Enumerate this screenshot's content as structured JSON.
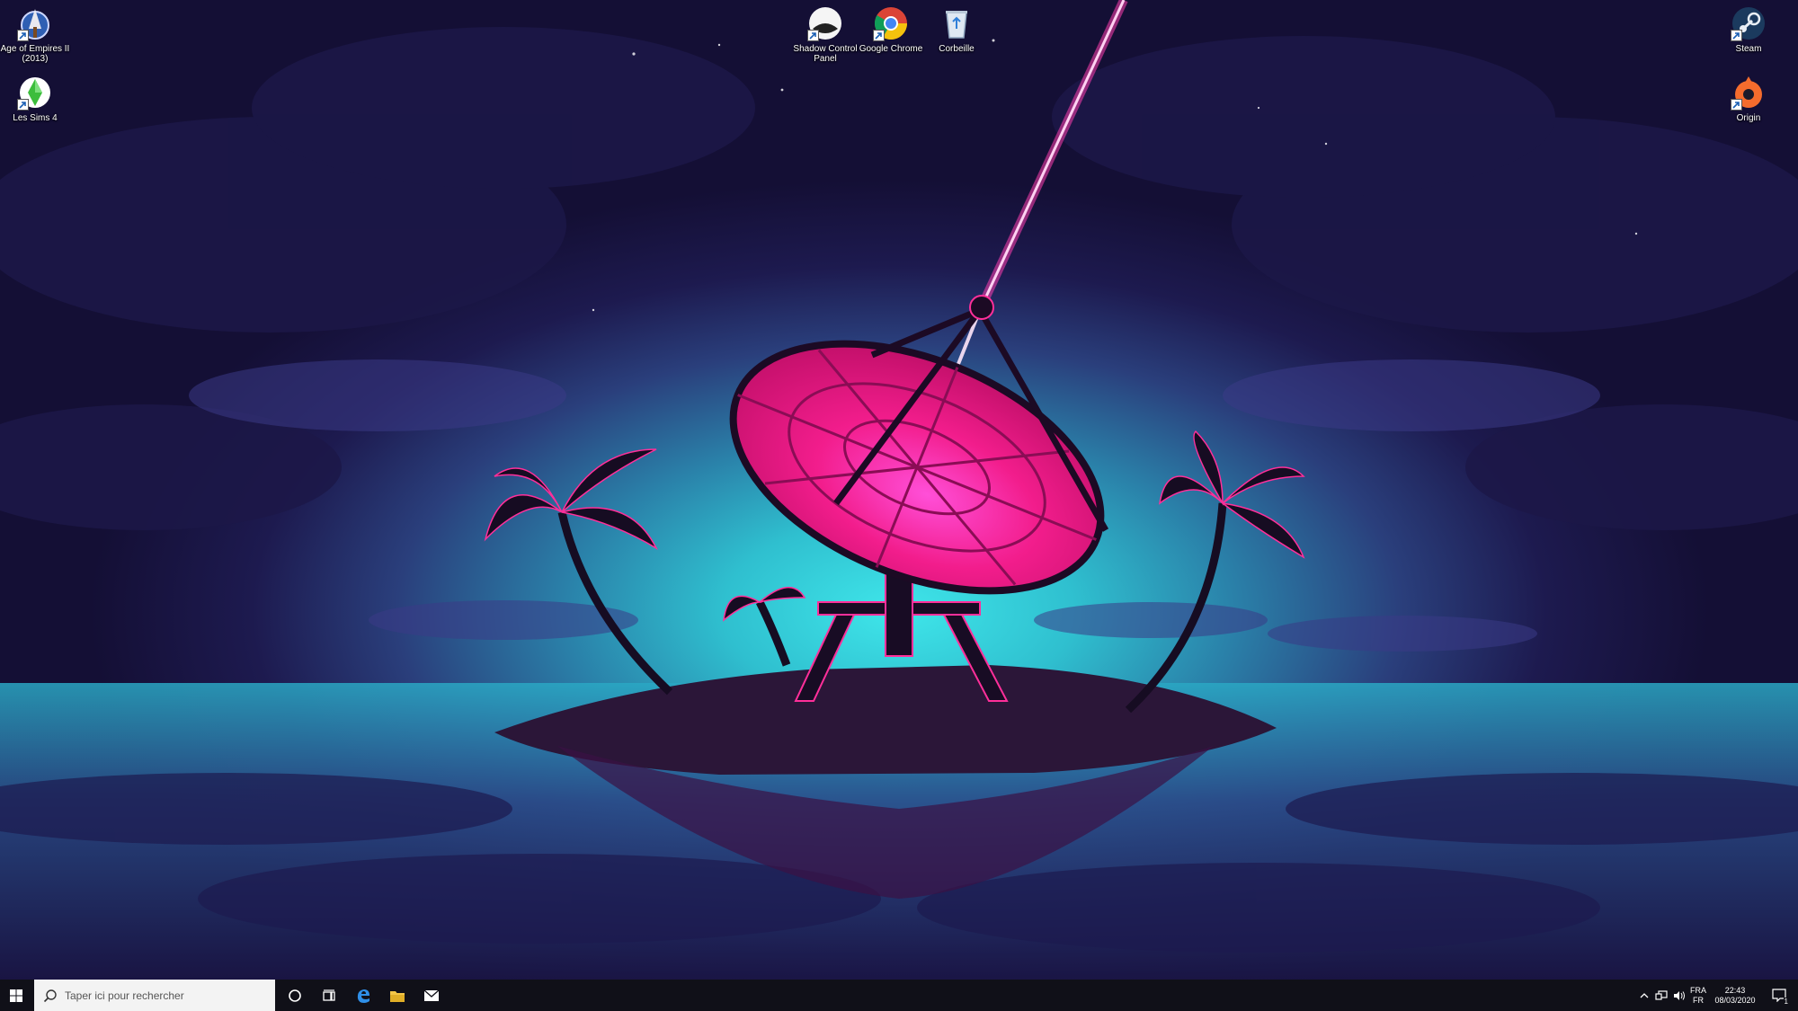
{
  "desktop": {
    "icons_left": [
      {
        "label": "Age of Empires II (2013)",
        "icon": "aoe2-icon"
      },
      {
        "label": "Les Sims 4",
        "icon": "sims4-icon"
      }
    ],
    "icons_center": [
      {
        "label": "Shadow Control Panel",
        "icon": "shadow-icon"
      },
      {
        "label": "Google Chrome",
        "icon": "chrome-icon"
      },
      {
        "label": "Corbeille",
        "icon": "recycle-bin-icon"
      }
    ],
    "icons_right": [
      {
        "label": "Steam",
        "icon": "steam-icon"
      },
      {
        "label": "Origin",
        "icon": "origin-icon"
      }
    ]
  },
  "taskbar": {
    "search_placeholder": "Taper ici pour rechercher",
    "pinned": [
      "start-icon",
      "cortana-icon",
      "task-view-icon",
      "edge-icon",
      "file-explorer-icon",
      "mail-icon"
    ],
    "tray": {
      "language_top": "FRA",
      "language_bottom": "FR",
      "time": "22:43",
      "date": "08/03/2020",
      "notification_count": "1"
    }
  },
  "colors": {
    "accent_pink": "#ff2f9a",
    "sky_cyan": "#3fe6ea",
    "night": "#140f35",
    "taskbar": "#101018"
  }
}
